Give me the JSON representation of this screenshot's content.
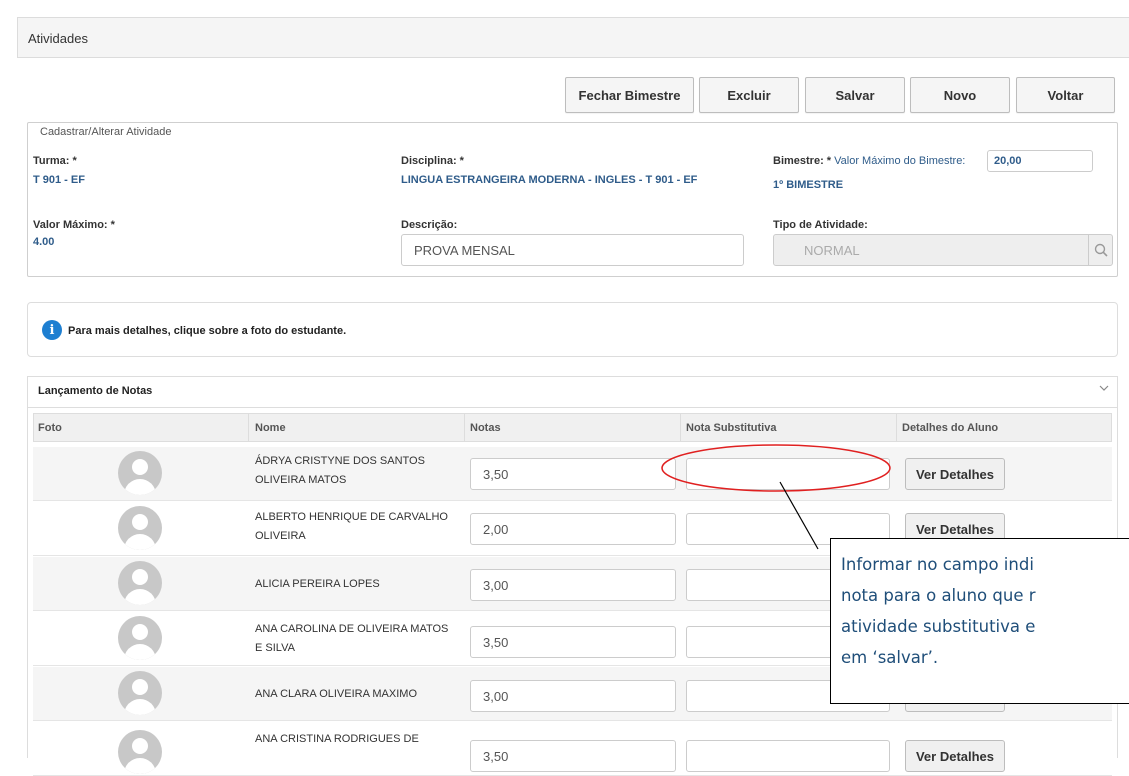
{
  "header": {
    "title": "Atividades"
  },
  "toolbar": {
    "close_bimester": "Fechar Bimestre",
    "delete": "Excluir",
    "save": "Salvar",
    "new": "Novo",
    "back": "Voltar"
  },
  "form": {
    "legend": "Cadastrar/Alterar Atividade",
    "turma_label": "Turma: *",
    "turma_value": "T 901 - EF",
    "disciplina_label": "Disciplina: *",
    "disciplina_value": "LINGUA ESTRANGEIRA MODERNA - INGLES - T 901 - EF",
    "bimestre_label": "Bimestre: *",
    "max_bimestre_label": "Valor Máximo do Bimestre:",
    "max_bimestre_value": "20,00",
    "bimestre_value": "1º BIMESTRE",
    "valor_max_label": "Valor Máximo: *",
    "valor_max_value": "4.00",
    "descricao_label": "Descrição:",
    "descricao_value": "PROVA MENSAL",
    "tipo_label": "Tipo de Atividade:",
    "tipo_value": "NORMAL"
  },
  "info": {
    "text": "Para mais detalhes, clique sobre a foto do estudante.",
    "icon": "info-icon"
  },
  "grades": {
    "title": "Lançamento de Notas",
    "columns": [
      "Foto",
      "Nome",
      "Notas",
      "Nota Substitutiva",
      "Detalhes do Aluno"
    ],
    "details_label": "Ver Detalhes",
    "rows": [
      {
        "name": "ÁDRYA CRISTYNE DOS SANTOS OLIVEIRA MATOS",
        "grade": "3,50",
        "substitute": ""
      },
      {
        "name": "ALBERTO HENRIQUE DE CARVALHO OLIVEIRA",
        "grade": "2,00",
        "substitute": ""
      },
      {
        "name": "ALICIA PEREIRA LOPES",
        "grade": "3,00",
        "substitute": ""
      },
      {
        "name": "ANA CAROLINA DE OLIVEIRA MATOS E SILVA",
        "grade": "3,50",
        "substitute": ""
      },
      {
        "name": "ANA CLARA OLIVEIRA MAXIMO",
        "grade": "3,00",
        "substitute": ""
      },
      {
        "name": "ANA CRISTINA RODRIGUES DE",
        "grade": "3,50",
        "substitute": ""
      }
    ]
  },
  "callout": {
    "lines": [
      "Informar no campo indi",
      "nota para o aluno que r",
      "atividade substitutiva e",
      "em ‘salvar’."
    ],
    "color": "#1f4e79"
  },
  "annotation": {
    "ellipse_color": "#e02020"
  }
}
